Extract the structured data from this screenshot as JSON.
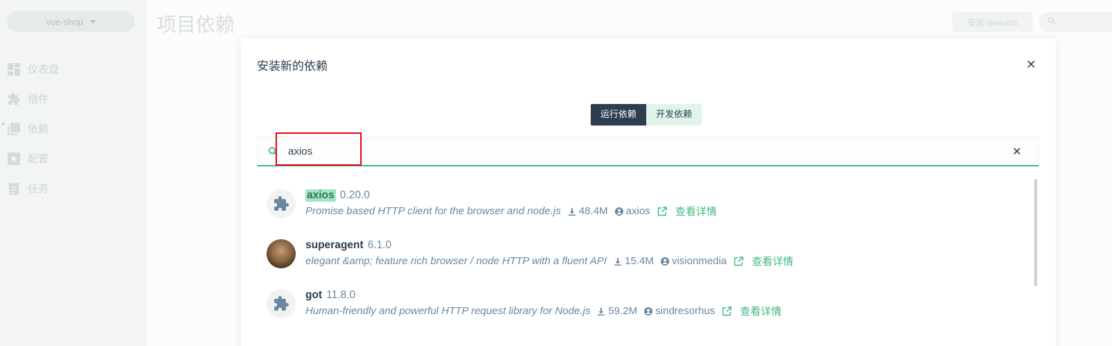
{
  "app": {
    "project_name": "vue-shop",
    "page_title": "项目依赖",
    "devtools_button": "安装 devtools",
    "nav": [
      {
        "label": "仪表盘",
        "icon": "dashboard-icon"
      },
      {
        "label": "插件",
        "icon": "puzzle-icon"
      },
      {
        "label": "依赖",
        "icon": "library-icon"
      },
      {
        "label": "配置",
        "icon": "settings-icon"
      },
      {
        "label": "任务",
        "icon": "clipboard-icon"
      }
    ]
  },
  "modal": {
    "title": "安装新的依赖",
    "toggle": {
      "runtime": "运行依赖",
      "dev": "开发依赖",
      "selected": "runtime"
    },
    "search": {
      "value": "axios",
      "placeholder": ""
    },
    "details_label": "查看详情",
    "results": [
      {
        "name": "axios",
        "version": "0.20.0",
        "description": "Promise based HTTP client for the browser and node.js",
        "downloads": "48.4M",
        "author": "axios",
        "logo": "puzzle-icon",
        "highlighted": true
      },
      {
        "name": "superagent",
        "version": "6.1.0",
        "description": "elegant &amp; feature rich browser / node HTTP with a fluent API",
        "downloads": "15.4M",
        "author": "visionmedia",
        "logo": "avatar",
        "highlighted": false
      },
      {
        "name": "got",
        "version": "11.8.0",
        "description": "Human-friendly and powerful HTTP request library for Node.js",
        "downloads": "59.2M",
        "author": "sindresorhus",
        "logo": "puzzle-icon",
        "highlighted": false
      }
    ]
  },
  "colors": {
    "accent": "#42b983",
    "dark": "#2c3e50",
    "annotation": "#e8000d"
  }
}
